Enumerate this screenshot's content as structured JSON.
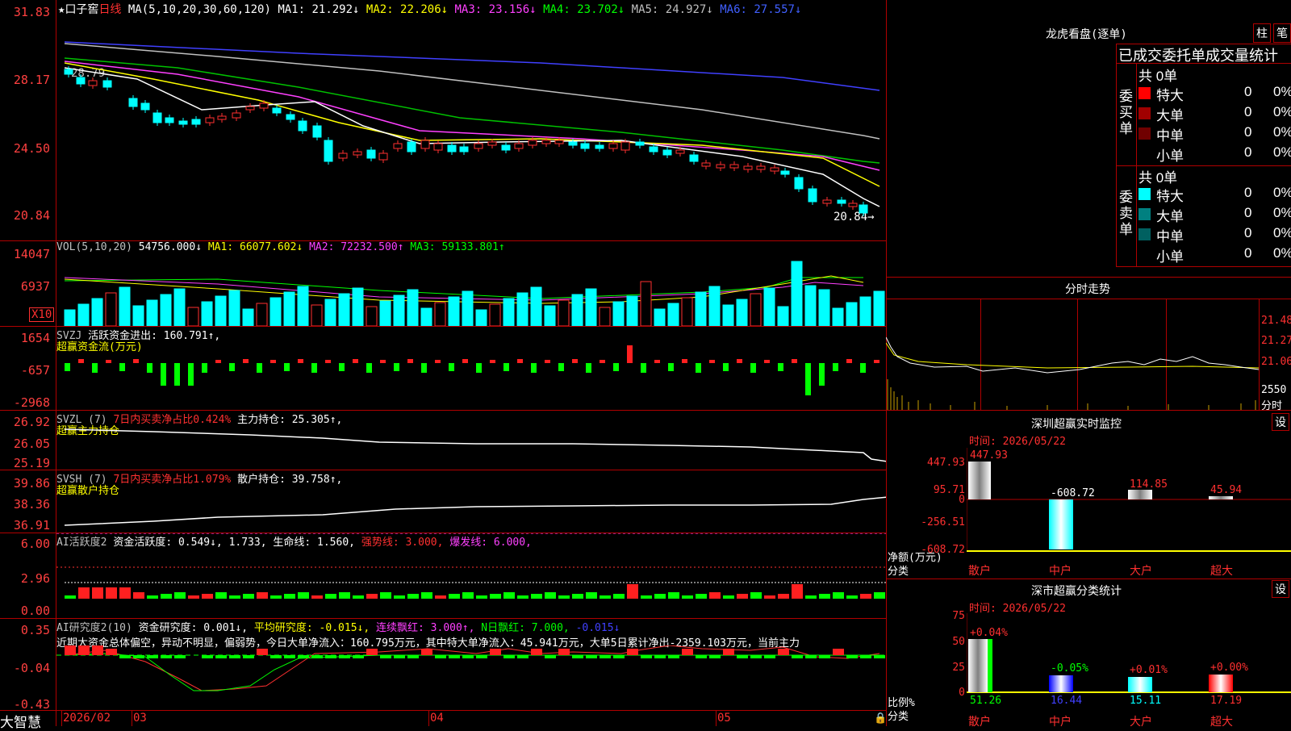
{
  "main": {
    "star": "★",
    "stock_name": "口子窖",
    "period": "日线",
    "ma_label": "MA(5,10,20,30,60,120)",
    "ma": [
      {
        "text": "MA1: 21.292↓",
        "color": "#ffffff"
      },
      {
        "text": "MA2: 22.206↓",
        "color": "#ffff00"
      },
      {
        "text": "MA3: 23.156↓",
        "color": "#ff40ff"
      },
      {
        "text": "MA4: 23.702↓",
        "color": "#00ff00"
      },
      {
        "text": "MA5: 24.927↓",
        "color": "#c0c0c0"
      },
      {
        "text": "MA6: 27.557↓",
        "color": "#4060ff"
      }
    ],
    "yaxis": [
      "31.83",
      "28.17",
      "24.50",
      "20.84"
    ],
    "high_label": "28.79",
    "low_label": "20.84→"
  },
  "vol": {
    "label": "VOL(5,10,20)",
    "value": "54756.000↓",
    "ma": [
      {
        "text": "MA1: 66077.602↓",
        "color": "#ffff00"
      },
      {
        "text": "MA2: 72232.500↑",
        "color": "#ff40ff"
      },
      {
        "text": "MA3: 59133.801↑",
        "color": "#00ff00"
      }
    ],
    "yaxis": [
      "14047",
      "6937"
    ],
    "unit": "X10"
  },
  "svzj": {
    "label": "SVZJ",
    "line": "活跃资金进出: 160.791↑,",
    "sub": "超赢资金流(万元)",
    "yaxis": [
      "1654",
      "-657",
      "-2968"
    ]
  },
  "svzl": {
    "label": "SVZL (7)",
    "desc": "7日内买卖净占比0.424%",
    "hold": "主力持仓: 25.305↑,",
    "sub": "超赢主力持仓",
    "yaxis": [
      "26.92",
      "26.05",
      "25.19"
    ]
  },
  "svsh": {
    "label": "SVSH (7)",
    "desc": "7日内买卖净占比1.079%",
    "hold": "散户持仓: 39.758↑,",
    "sub": "超赢散户持仓",
    "yaxis": [
      "39.86",
      "38.36",
      "36.91"
    ]
  },
  "ai1": {
    "label": "AI活跃度2",
    "t1": "资金活跃度: 0.549↓, 1.733, 生命线: 1.560,",
    "t2": "强势线: 3.000,",
    "t3": "爆发线: 6.000,",
    "yaxis": [
      "6.00",
      "2.96",
      "0.00"
    ]
  },
  "ai2": {
    "label": "AI研究度2(10)",
    "t1": "资金研究度: 0.001↓,",
    "t2": "平均研究度: -0.015↓,",
    "t3": "连续飘红: 3.000↑,",
    "t4": "N日飘红: 7.000,",
    "t5": "-0.015↓",
    "comment": "近期大资金总体偏空，异动不明显，偏弱势，今日大单净流入：160.795万元，其中特大单净流入：45.941万元，大单5日累计净出-2359.103万元，当前主力",
    "yaxis": [
      "0.35",
      "-0.04",
      "-0.43"
    ]
  },
  "bottom": {
    "brand": "大智慧",
    "dates": [
      "2026/02",
      "03",
      "04",
      "05"
    ]
  },
  "dragon": {
    "title": "龙虎看盘(逐单)",
    "btn1": "柱",
    "btn2": "笔",
    "header": "已成交委托单成交量统计",
    "buy_total": "共 0单",
    "buy_label": "委买单",
    "sell_total": "共 0单",
    "sell_label": "委卖单",
    "buy_rows": [
      {
        "name": "特大",
        "val": "0",
        "pct": "0%",
        "color": "#ff0000"
      },
      {
        "name": "大单",
        "val": "0",
        "pct": "0%",
        "color": "#a00000"
      },
      {
        "name": "中单",
        "val": "0",
        "pct": "0%",
        "color": "#700000"
      },
      {
        "name": "小单",
        "val": "0",
        "pct": "0%",
        "color": "#000000"
      }
    ],
    "sell_rows": [
      {
        "name": "特大",
        "val": "0",
        "pct": "0%",
        "color": "#00ffff"
      },
      {
        "name": "大单",
        "val": "0",
        "pct": "0%",
        "color": "#008080"
      },
      {
        "name": "中单",
        "val": "0",
        "pct": "0%",
        "color": "#006060"
      },
      {
        "name": "小单",
        "val": "0",
        "pct": "0%",
        "color": "#000000"
      }
    ]
  },
  "intraday": {
    "title": "分时走势",
    "prices": [
      "21.48",
      "21.27",
      "21.06"
    ],
    "vol_label": "2550",
    "unit": "分时"
  },
  "monitor": {
    "title": "深圳超赢实时监控",
    "btn": "设",
    "time": "时间: 2026/05/22",
    "yaxis": [
      "447.93",
      "95.71",
      "0",
      "-256.51",
      "-608.72"
    ],
    "label_net": "净额(万元)",
    "label_cls": "分类",
    "bars": [
      {
        "name": "散户",
        "value": "447.93"
      },
      {
        "name": "中户",
        "value": "-608.72"
      },
      {
        "name": "大户",
        "value": "114.85"
      },
      {
        "name": "超大",
        "value": "45.94"
      }
    ]
  },
  "classify": {
    "title": "深市超赢分类统计",
    "btn": "设",
    "time": "时间: 2026/05/22",
    "yaxis": [
      "75",
      "50",
      "25",
      "0"
    ],
    "label_ratio": "比例%",
    "label_cls": "分类",
    "bars": [
      {
        "name": "散户",
        "pct": "+0.04%",
        "value": "51.26"
      },
      {
        "name": "中户",
        "pct": "-0.05%",
        "value": "16.44"
      },
      {
        "name": "大户",
        "pct": "+0.01%",
        "value": "15.11"
      },
      {
        "name": "超大",
        "pct": "+0.00%",
        "value": "17.19"
      }
    ]
  }
}
